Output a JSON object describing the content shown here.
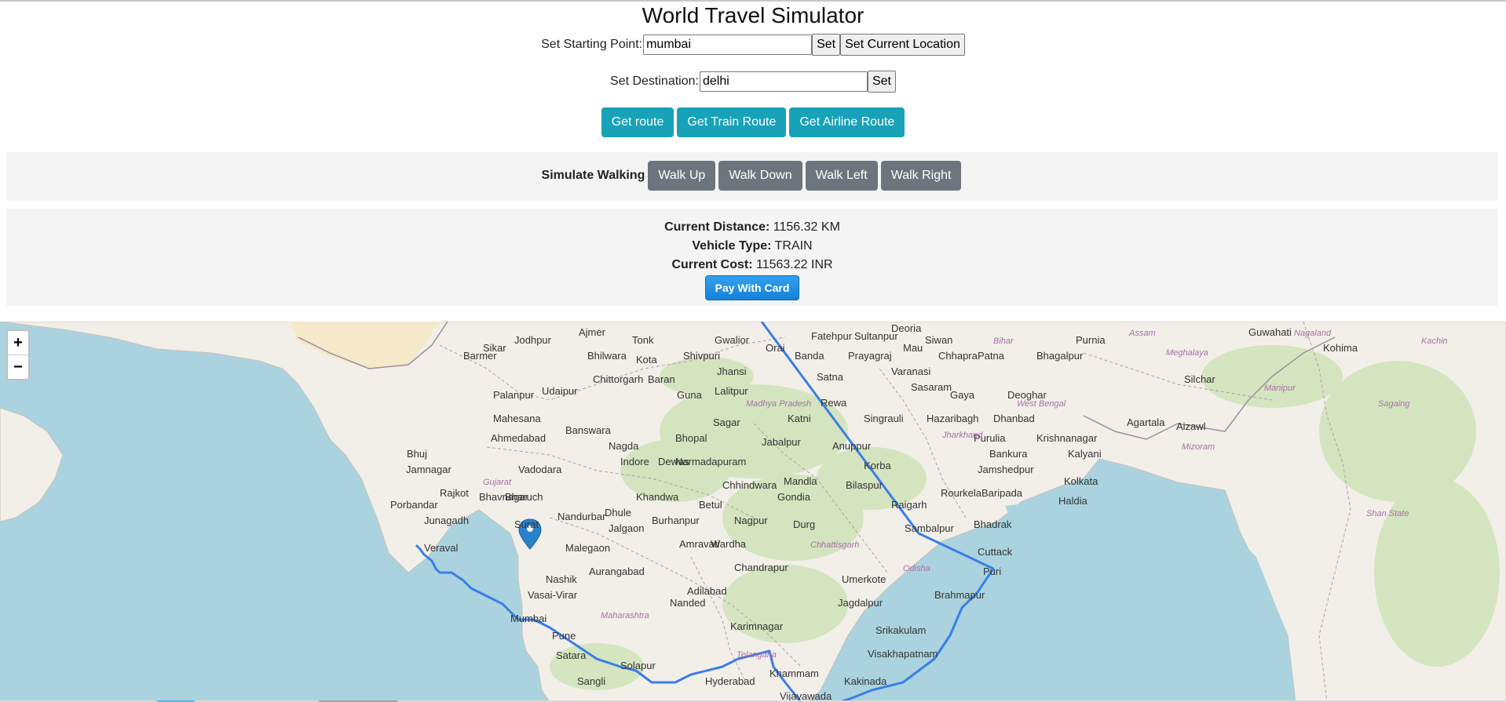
{
  "page_title": "World Travel Simulator",
  "starting_point": {
    "label": "Set Starting Point:",
    "value": "mumbai",
    "set_label": "Set",
    "current_location_label": "Set Current Location"
  },
  "destination": {
    "label": "Set Destination:",
    "value": "delhi",
    "set_label": "Set"
  },
  "route_buttons": {
    "get_route": "Get route",
    "get_train_route": "Get Train Route",
    "get_airline_route": "Get Airline Route"
  },
  "walking": {
    "label": "Simulate Walking",
    "up": "Walk Up",
    "down": "Walk Down",
    "left": "Walk Left",
    "right": "Walk Right"
  },
  "stats": {
    "distance_label": "Current Distance:",
    "distance_value": "1156.32 KM",
    "vehicle_label": "Vehicle Type:",
    "vehicle_value": "TRAIN",
    "cost_label": "Current Cost:",
    "cost_value": "11563.22 INR",
    "pay_label": "Pay With Card"
  },
  "map": {
    "zoom_in": "+",
    "zoom_out": "−",
    "route_color": "#3a7ee8",
    "places": [
      "Jodhpur",
      "Ajmer",
      "Tonk",
      "Gwalior",
      "Orai",
      "Banda",
      "Fatehpur",
      "Sultanpur",
      "Prayagraj",
      "Varanasi",
      "Patna",
      "Bhagalpur",
      "Purnia",
      "Guwahati",
      "Kohima",
      "Udaipur",
      "Kota",
      "Bhilwara",
      "Chittorgarh",
      "Palanpur",
      "Mahesana",
      "Ahmedabad",
      "Vadodara",
      "Bharuch",
      "Surat",
      "Rajkot",
      "Jamnagar",
      "Bhavnagar",
      "Junagadh",
      "Porbandar",
      "Veraval",
      "Nashik",
      "Vasai-Virar",
      "Mumbai",
      "Pune",
      "Satara",
      "Sangli",
      "Solapur",
      "Aurangabad",
      "Malegaon",
      "Jalgaon",
      "Nanded",
      "Nagpur",
      "Amravati",
      "Wardha",
      "Chandrapur",
      "Adilabad",
      "Karimnagar",
      "Hyderabad",
      "Khammam",
      "Vijayawada",
      "Kakinada",
      "Visakhapatnam",
      "Srikakulam",
      "Brahmapur",
      "Cuttack",
      "Puri",
      "Bhopal",
      "Jabalpur",
      "Indore",
      "Sagar",
      "Jhansi",
      "Lalitpur",
      "Rewa",
      "Katni",
      "Satna",
      "Mandla",
      "Bilaspur",
      "Raigarh",
      "Korba",
      "Sambalpur",
      "Rourkela",
      "Jamshedpur",
      "Dhanbad",
      "Hazaribagh",
      "Kolkata",
      "Haldia",
      "Baripada",
      "Bhadrak",
      "Durg",
      "Gondia",
      "Umerkote",
      "Jagdalpur",
      "Betul",
      "Khandwa",
      "Burhanpur",
      "Nandurbar",
      "Bhuj",
      "Dhule",
      "Barmer",
      "Deoghar",
      "Gaya",
      "Sasaram",
      "Agartala",
      "Aizawl",
      "Silchar",
      "Krishnanagar",
      "Purulia",
      "Kalyani",
      "Bankura",
      "Dewas",
      "Sikar",
      "Siwan",
      "Chhapra",
      "Nagda",
      "Banswara",
      "Shivpuri",
      "Baran",
      "Guna",
      "Narmadapuram",
      "Chhindwara",
      "Anuppur",
      "Singrauli",
      "Deoria",
      "Mau"
    ],
    "regions": [
      "Madhya Pradesh",
      "Gujarat",
      "Maharashtra",
      "Telangana",
      "Chhattisgarh",
      "Odisha",
      "Jharkhand",
      "West Bengal",
      "Bihar",
      "Assam",
      "Meghalaya",
      "Manipur",
      "Nagaland",
      "Mizoram",
      "Shan State",
      "Sagaing",
      "Kachin"
    ]
  }
}
